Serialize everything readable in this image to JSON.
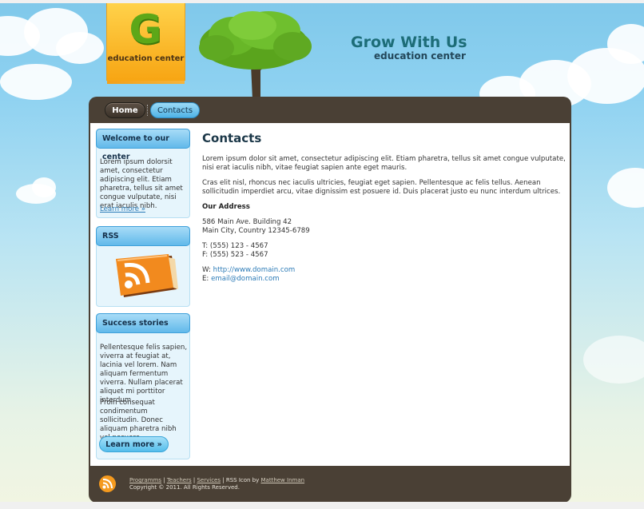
{
  "brand": {
    "logo_letter": "G",
    "logo_caption": "education center",
    "title": "Grow With Us",
    "subtitle": "education center"
  },
  "nav": {
    "items": [
      {
        "label": "Home"
      },
      {
        "label": "Contacts"
      }
    ]
  },
  "sidebar": {
    "welcome": {
      "title": "Welcome to our center",
      "text": "Lorem ipsum dolorsit amet, consectetur adipiscing elit. Etiam pharetra, tellus sit amet congue vulputate, nisi erat iaculis nibh.",
      "link": "Learn more »"
    },
    "rss": {
      "title": "RSS"
    },
    "success": {
      "title": "Success stories",
      "text1": "Pellentesque felis sapien, viverra at feugiat at, lacinia vel lorem. Nam aliquam fermentum viverra. Nullam placerat aliquet mi porttitor interdum.",
      "text2": "Proin consequat condimentum sollicitudin. Donec aliquam pharetra nibh vel posuere.",
      "button": "Learn more »"
    }
  },
  "main": {
    "title": "Contacts",
    "para1": "Lorem ipsum dolor sit amet, consectetur adipiscing elit. Etiam pharetra, tellus sit amet congue vulputate, nisi erat iaculis nibh, vitae feugiat sapien ante eget mauris.",
    "para2": "Cras elit nisl, rhoncus nec iaculis ultricies, feugiat eget sapien. Pellentesque ac felis tellus. Aenean sollicitudin imperdiet arcu, vitae dignissim est posuere id. Duis placerat justo eu nunc interdum ultrices.",
    "address_heading": "Our Address",
    "address_line1": "586 Main Ave. Building 42",
    "address_line2": "Main City, Country 12345-6789",
    "phone": "T: (555) 123 - 4567",
    "fax": "F: (555) 523 - 4567",
    "web_prefix": "W:",
    "web": "http://www.domain.com",
    "email_prefix": "E:",
    "email": "email@domain.com"
  },
  "footer": {
    "links": [
      "Programms",
      "Teachers",
      "Services"
    ],
    "sep": "|",
    "rss_text": "RSS Icon by",
    "rss_author": "Matthew Inman",
    "copyright": "Copyright © 2011. All Rights Reserved."
  },
  "colors": {
    "accent_blue": "#4fb2e6",
    "container_brown": "#4a4035",
    "logo_orange": "#f7a513",
    "logo_green": "#5da718",
    "title_teal": "#1d6d78"
  },
  "icons": [
    "rss-book-icon",
    "rss-footer-icon",
    "tree-illustration"
  ]
}
